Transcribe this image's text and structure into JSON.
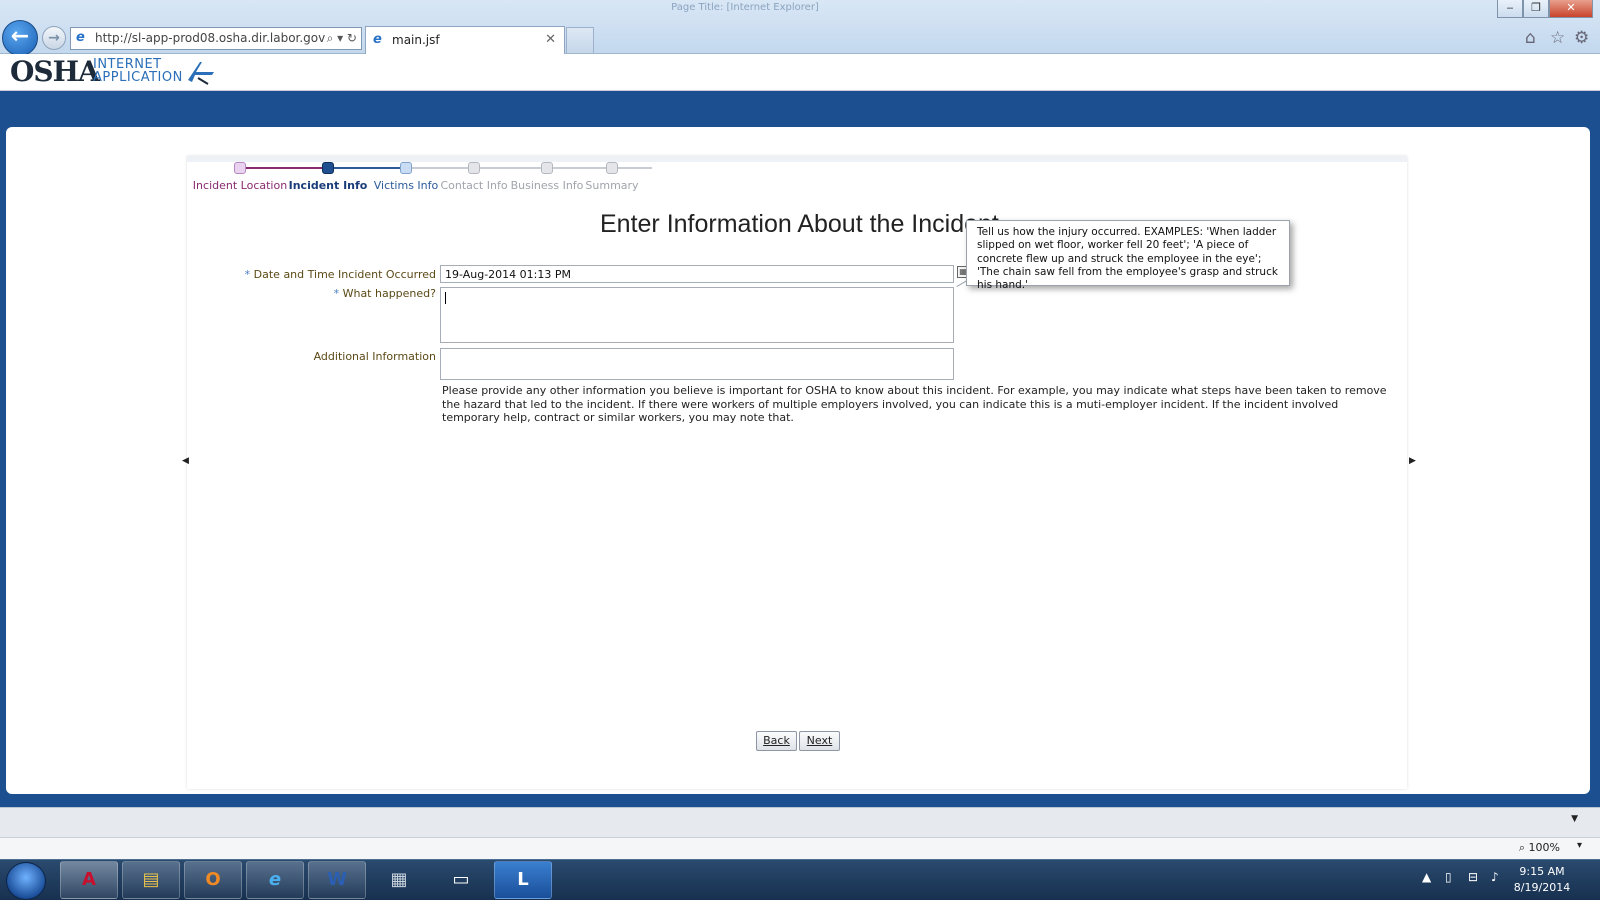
{
  "browser": {
    "window_title": "Page Title: [Internet Explorer]",
    "address": "http://sl-app-prod08.osha.dir.labor.gov",
    "tab_title": "main.jsf"
  },
  "header": {
    "logo": "OSHA",
    "app_line1": "INTERNET",
    "app_line2": "APPLICATION"
  },
  "train": [
    {
      "label": "Incident Location",
      "state": "visited"
    },
    {
      "label": "Incident Info",
      "state": "current"
    },
    {
      "label": "Victims Info",
      "state": "next"
    },
    {
      "label": "Contact Info",
      "state": "disabled"
    },
    {
      "label": "Business Info",
      "state": "disabled"
    },
    {
      "label": "Summary",
      "state": "disabled"
    }
  ],
  "form": {
    "title": "Enter Information About the Incident",
    "required_mark": "*",
    "date_label": "Date and Time Incident Occurred",
    "date_value": "19-Aug-2014 01:13 PM",
    "what_label": "What happened?",
    "what_value": "",
    "additional_label": "Additional Information",
    "additional_value": "",
    "additional_help": "Please provide any other information you believe is important for OSHA to know about this incident. For example, you may indicate what steps have been taken to remove the hazard that led to the incident. If there were workers of multiple employers involved, you can indicate this is a muti-employer incident. If the incident involved temporary help, contract or similar workers, you may note that.",
    "tooltip": "Tell us how the injury occurred. EXAMPLES: 'When ladder slipped on wet floor, worker fell 20 feet'; 'A piece of concrete flew up and struck the employee in the eye'; 'The chain saw fell from the employee's grasp and struck his hand.'",
    "back_label": "Back",
    "next_label": "Next"
  },
  "statusbar": {
    "zoom": "100%"
  },
  "taskbar": {
    "time": "9:15 AM",
    "date": "8/19/2014"
  },
  "colors": {
    "brand_blue": "#1b4f90",
    "train_visited": "#8a2a6e",
    "train_current": "#1a3d7a",
    "label_brown": "#5b4a16"
  }
}
